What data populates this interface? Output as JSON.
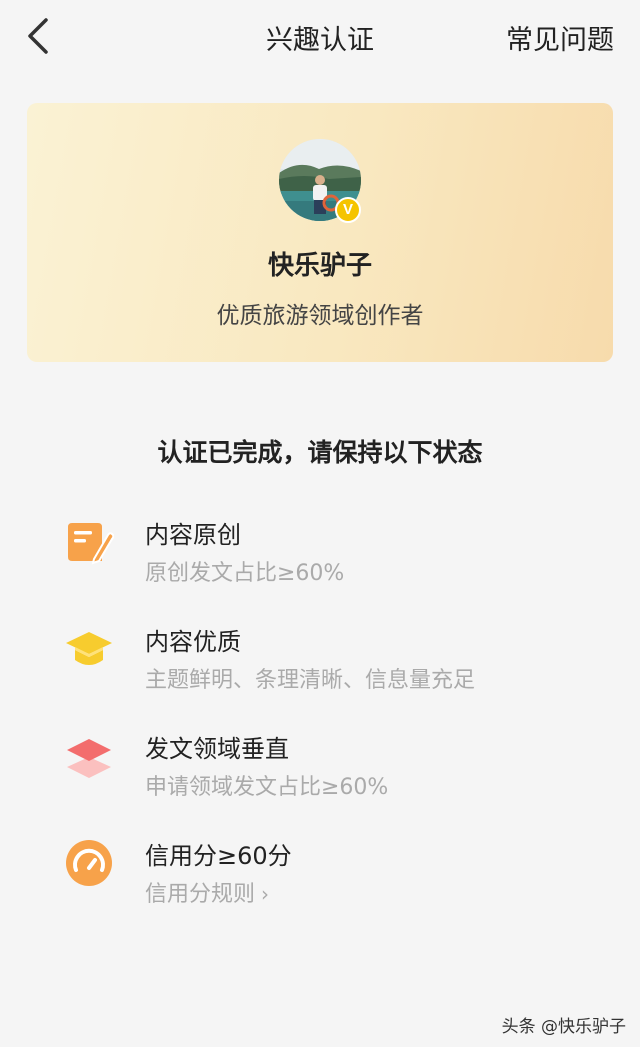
{
  "nav": {
    "title": "兴趣认证",
    "faq_label": "常见问题"
  },
  "profile": {
    "name": "快乐驴子",
    "description": "优质旅游领域创作者",
    "badge": "V"
  },
  "status_heading": "认证已完成，请保持以下状态",
  "requirements": [
    {
      "title": "内容原创",
      "subtitle": "原创发文占比≥60%"
    },
    {
      "title": "内容优质",
      "subtitle": "主题鲜明、条理清晰、信息量充足"
    },
    {
      "title": "发文领域垂直",
      "subtitle": "申请领域发文占比≥60%"
    },
    {
      "title": "信用分≥60分",
      "subtitle": "信用分规则"
    }
  ],
  "watermark": "头条 @快乐驴子",
  "colors": {
    "accent_orange": "#f7a24a",
    "accent_yellow": "#f7cc2e",
    "accent_red": "#f36d6d",
    "card_bg": "#f9e8c0"
  }
}
